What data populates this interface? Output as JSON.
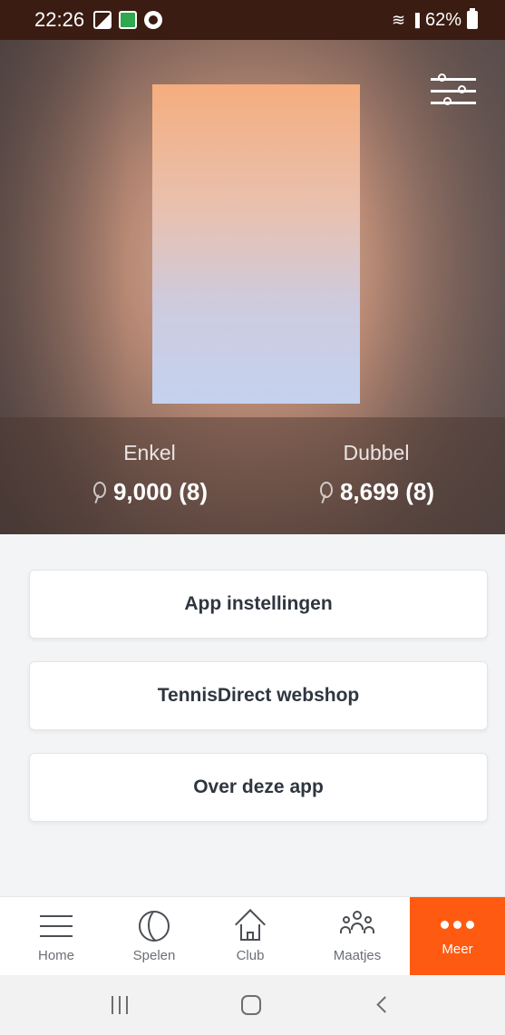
{
  "status_bar": {
    "time": "22:26",
    "battery": "62%",
    "icons": [
      "gallery-icon",
      "app-notification-icon",
      "app-circle-icon",
      "wifi-icon",
      "signal-icon",
      "battery-icon"
    ]
  },
  "profile": {
    "filter_icon": "sliders-icon",
    "ratings": {
      "enkel": {
        "label": "Enkel",
        "value": "9,000 (8)"
      },
      "dubbel": {
        "label": "Dubbel",
        "value": "8,699 (8)"
      }
    }
  },
  "menu": {
    "items": [
      {
        "label": "App instellingen"
      },
      {
        "label": "TennisDirect webshop"
      },
      {
        "label": "Over deze app"
      }
    ]
  },
  "bottom_nav": {
    "active": "Meer",
    "accent_color": "#ff5a11",
    "tabs": [
      {
        "label": "Home",
        "icon": "hamburger-icon"
      },
      {
        "label": "Spelen",
        "icon": "tennis-ball-icon"
      },
      {
        "label": "Club",
        "icon": "house-icon"
      },
      {
        "label": "Maatjes",
        "icon": "people-icon"
      },
      {
        "label": "Meer",
        "icon": "more-dots-icon"
      }
    ]
  }
}
